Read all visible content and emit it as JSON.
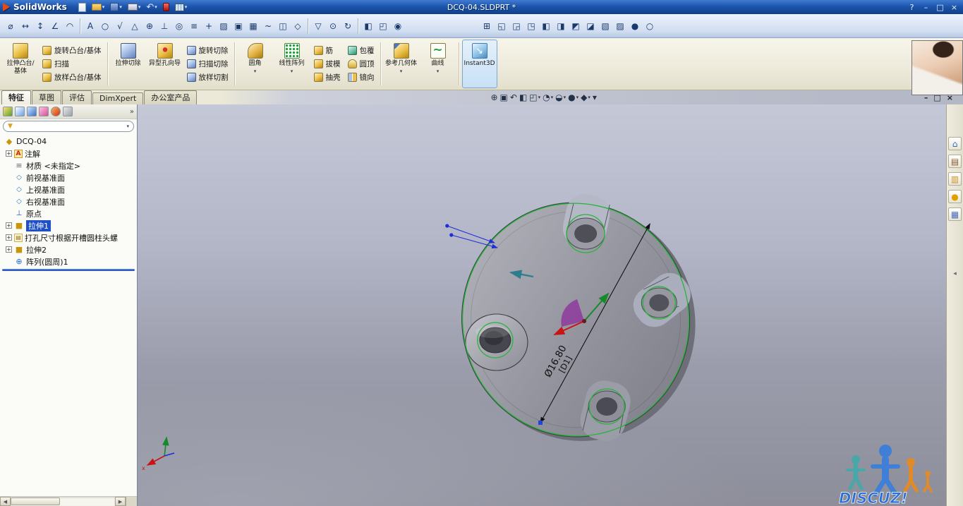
{
  "colors": {
    "titlebar_blue": "#1d56ad",
    "ribbon_tan": "#ece9d8",
    "selection_blue": "#2050c8",
    "rollback_blue": "#1d46b4",
    "highlight_green": "#27b43a",
    "part_gray": "#9a9aa4",
    "instant3d_active_bg": "#c8e0f6",
    "watermark_blue": "#2e6fd6"
  },
  "ui": {
    "dropdown_glyph": "▾",
    "chevron_glyph": "»",
    "filter_glyph": "▼",
    "scroll_left": "◀",
    "scroll_right": "▶",
    "collapse_glyph": "◂",
    "undo_glyph": "↶"
  },
  "window": {
    "app_name": "SolidWorks",
    "doc_title": "DCQ-04.SLDPRT *",
    "help_label": "?",
    "minimize": "–",
    "maximize": "□",
    "close": "×"
  },
  "toolbar1": {
    "icons": [
      "new-document",
      "open-document",
      "save",
      "print",
      "undo",
      "rebuild",
      "options-table"
    ]
  },
  "toolbar2": {
    "left": [
      {
        "name": "smart-dimension",
        "glyph": "⌀"
      },
      {
        "name": "horizontal-dimension",
        "glyph": "↔"
      },
      {
        "name": "vertical-dimension",
        "glyph": "↕"
      },
      {
        "name": "angle-dimension",
        "glyph": "∠"
      },
      {
        "name": "arc-dimension",
        "glyph": "◠"
      },
      {
        "name": "note",
        "glyph": "A"
      },
      {
        "name": "balloon",
        "glyph": "○"
      },
      {
        "name": "surface-finish",
        "glyph": "√"
      },
      {
        "name": "weld-symbol",
        "glyph": "△"
      },
      {
        "name": "geometric-tolerance",
        "glyph": "⊕"
      },
      {
        "name": "datum-feature",
        "glyph": "⊥"
      },
      {
        "name": "hole-callout",
        "glyph": "◎"
      },
      {
        "name": "centerline",
        "glyph": "≡"
      },
      {
        "name": "center-mark",
        "glyph": "+"
      },
      {
        "name": "area-hatch",
        "glyph": "▨"
      },
      {
        "name": "block",
        "glyph": "▣"
      },
      {
        "name": "table",
        "glyph": "▦"
      },
      {
        "name": "spline",
        "glyph": "~"
      },
      {
        "name": "mirror-entities",
        "glyph": "◫"
      },
      {
        "name": "offset-entities",
        "glyph": "◇"
      }
    ],
    "mid": [
      {
        "name": "selection-filter",
        "glyph": "▽"
      },
      {
        "name": "zoom-to-selection",
        "glyph": "⊙"
      },
      {
        "name": "rebuild-view",
        "glyph": "↻"
      }
    ],
    "mid2": [
      {
        "name": "section-view",
        "glyph": "◧"
      },
      {
        "name": "view-orientation",
        "glyph": "◰"
      },
      {
        "name": "camera-view",
        "glyph": "◉"
      }
    ],
    "right": [
      {
        "name": "zoom-fit",
        "glyph": "⊞"
      },
      {
        "name": "front-view",
        "glyph": "◱"
      },
      {
        "name": "back-view",
        "glyph": "◲"
      },
      {
        "name": "left-view",
        "glyph": "◳"
      },
      {
        "name": "right-view",
        "glyph": "◧"
      },
      {
        "name": "top-view",
        "glyph": "◨"
      },
      {
        "name": "bottom-view",
        "glyph": "◩"
      },
      {
        "name": "isometric-view",
        "glyph": "◪"
      },
      {
        "name": "dimetric-view",
        "glyph": "▧"
      },
      {
        "name": "trimetric-view",
        "glyph": "▨"
      },
      {
        "name": "shaded-view",
        "glyph": "●"
      },
      {
        "name": "wireframe-view",
        "glyph": "○"
      }
    ]
  },
  "ribbon": {
    "buttons": [
      {
        "label": "拉伸凸台/基体"
      },
      {
        "label": "旋转凸台/基体"
      },
      {
        "label": "扫描"
      },
      {
        "label": "放样凸台/基体"
      },
      {
        "label": "拉伸切除"
      },
      {
        "label": "异型孔向导"
      },
      {
        "label": "旋转切除"
      },
      {
        "label": "扫描切除"
      },
      {
        "label": "放样切割"
      },
      {
        "label": "圆角"
      },
      {
        "label": "线性阵列"
      },
      {
        "label": "筋"
      },
      {
        "label": "拔模"
      },
      {
        "label": "抽壳"
      },
      {
        "label": "包覆"
      },
      {
        "label": "圆顶"
      },
      {
        "label": "镜向"
      },
      {
        "label": "参考几何体"
      },
      {
        "label": "曲线"
      },
      {
        "label": "Instant3D",
        "active": true
      }
    ]
  },
  "tabs": {
    "items": [
      {
        "label": "特征",
        "active": true
      },
      {
        "label": "草图"
      },
      {
        "label": "评估"
      },
      {
        "label": "DimXpert"
      },
      {
        "label": "办公室产品"
      }
    ]
  },
  "hud": {
    "icons": [
      {
        "name": "zoom-to-fit",
        "glyph": "⊕"
      },
      {
        "name": "zoom-to-area",
        "glyph": "▣"
      },
      {
        "name": "previous-view",
        "glyph": "↶"
      },
      {
        "name": "section-view",
        "glyph": "◧"
      },
      {
        "name": "view-orientation",
        "glyph": "◰"
      },
      {
        "name": "display-style",
        "glyph": "◔"
      },
      {
        "name": "hide-show-items",
        "glyph": "◒"
      },
      {
        "name": "edit-appearance",
        "glyph": "●"
      },
      {
        "name": "apply-scene",
        "glyph": "◆"
      },
      {
        "name": "view-settings",
        "glyph": "▾"
      }
    ]
  },
  "feature_tree": {
    "root_label": "DCQ-04",
    "root_glyph": "◆",
    "items": [
      {
        "label": "注解",
        "glyph": "A",
        "expand": "+"
      },
      {
        "label": "材质 <未指定>",
        "glyph": "≡",
        "expand": ""
      },
      {
        "label": "前视基准面",
        "glyph": "◇",
        "expand": ""
      },
      {
        "label": "上视基准面",
        "glyph": "◇",
        "expand": ""
      },
      {
        "label": "右视基准面",
        "glyph": "◇",
        "expand": ""
      },
      {
        "label": "原点",
        "glyph": "⊥",
        "expand": ""
      },
      {
        "label": "拉伸1",
        "glyph": "■",
        "expand": "+",
        "selected": true
      },
      {
        "label": "打孔尺寸根据开槽圆柱头螺",
        "glyph": "▤",
        "expand": "+"
      },
      {
        "label": "拉伸2",
        "glyph": "■",
        "expand": "+"
      },
      {
        "label": "阵列(圆周)1",
        "glyph": "⊕",
        "expand": ""
      }
    ]
  },
  "task_pane": {
    "icons": [
      {
        "name": "solidworks-resources-home",
        "glyph": "⌂"
      },
      {
        "name": "design-library",
        "glyph": "▤"
      },
      {
        "name": "file-explorer",
        "glyph": "▥"
      },
      {
        "name": "appearances-scenes",
        "glyph": "●"
      },
      {
        "name": "custom-properties",
        "glyph": "▦"
      }
    ]
  },
  "viewport": {
    "dimension_value": "Ø16.80",
    "dimension_name": "[D1]"
  },
  "watermark": {
    "text": "DISCUZ!"
  }
}
